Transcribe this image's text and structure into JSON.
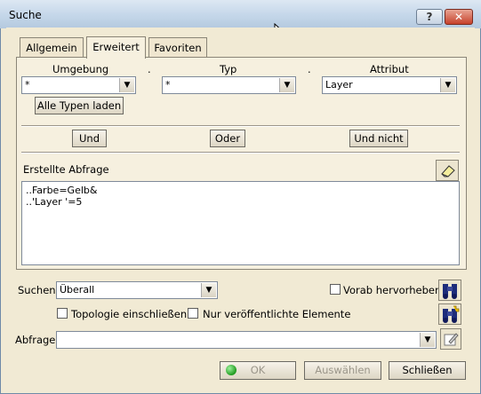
{
  "window": {
    "title": "Suche",
    "help_label": "?",
    "close_label": "✕"
  },
  "tabs": [
    {
      "label": "Allgemein"
    },
    {
      "label": "Erweitert"
    },
    {
      "label": "Favoriten"
    }
  ],
  "advanced": {
    "col1": {
      "label": "Umgebung",
      "value": "*"
    },
    "dot1": ".",
    "col2": {
      "label": "Typ",
      "value": "*"
    },
    "dot2": ".",
    "col3": {
      "label": "Attribut",
      "value": "Layer"
    },
    "load_types_label": "Alle Typen laden",
    "and_label": "Und",
    "or_label": "Oder",
    "and_not_label": "Und nicht",
    "query_heading": "Erstellte Abfrage",
    "query_lines": [
      "..Farbe=Gelb&",
      "..'Layer '=5"
    ]
  },
  "search": {
    "label": "Suchen:",
    "value": "Überall",
    "highlight_label": "Vorab hervorheben",
    "topology_label": "Topologie einschließen",
    "published_label": "Nur veröffentlichte Elemente",
    "query_label": "Abfrage:",
    "query_value": ""
  },
  "footer": {
    "ok_label": "OK",
    "select_label": "Auswählen",
    "close_label": "Schließen"
  },
  "icons": {
    "help": "help-icon",
    "close": "close-icon",
    "eraser": "eraser-icon",
    "binoculars": "binoculars-icon",
    "binoculars_add": "binoculars-add-icon",
    "edit_query": "edit-query-icon",
    "ok": "ok-dot-icon",
    "dropdown": "chevron-down-icon",
    "cursor": "mouse-cursor-icon"
  }
}
